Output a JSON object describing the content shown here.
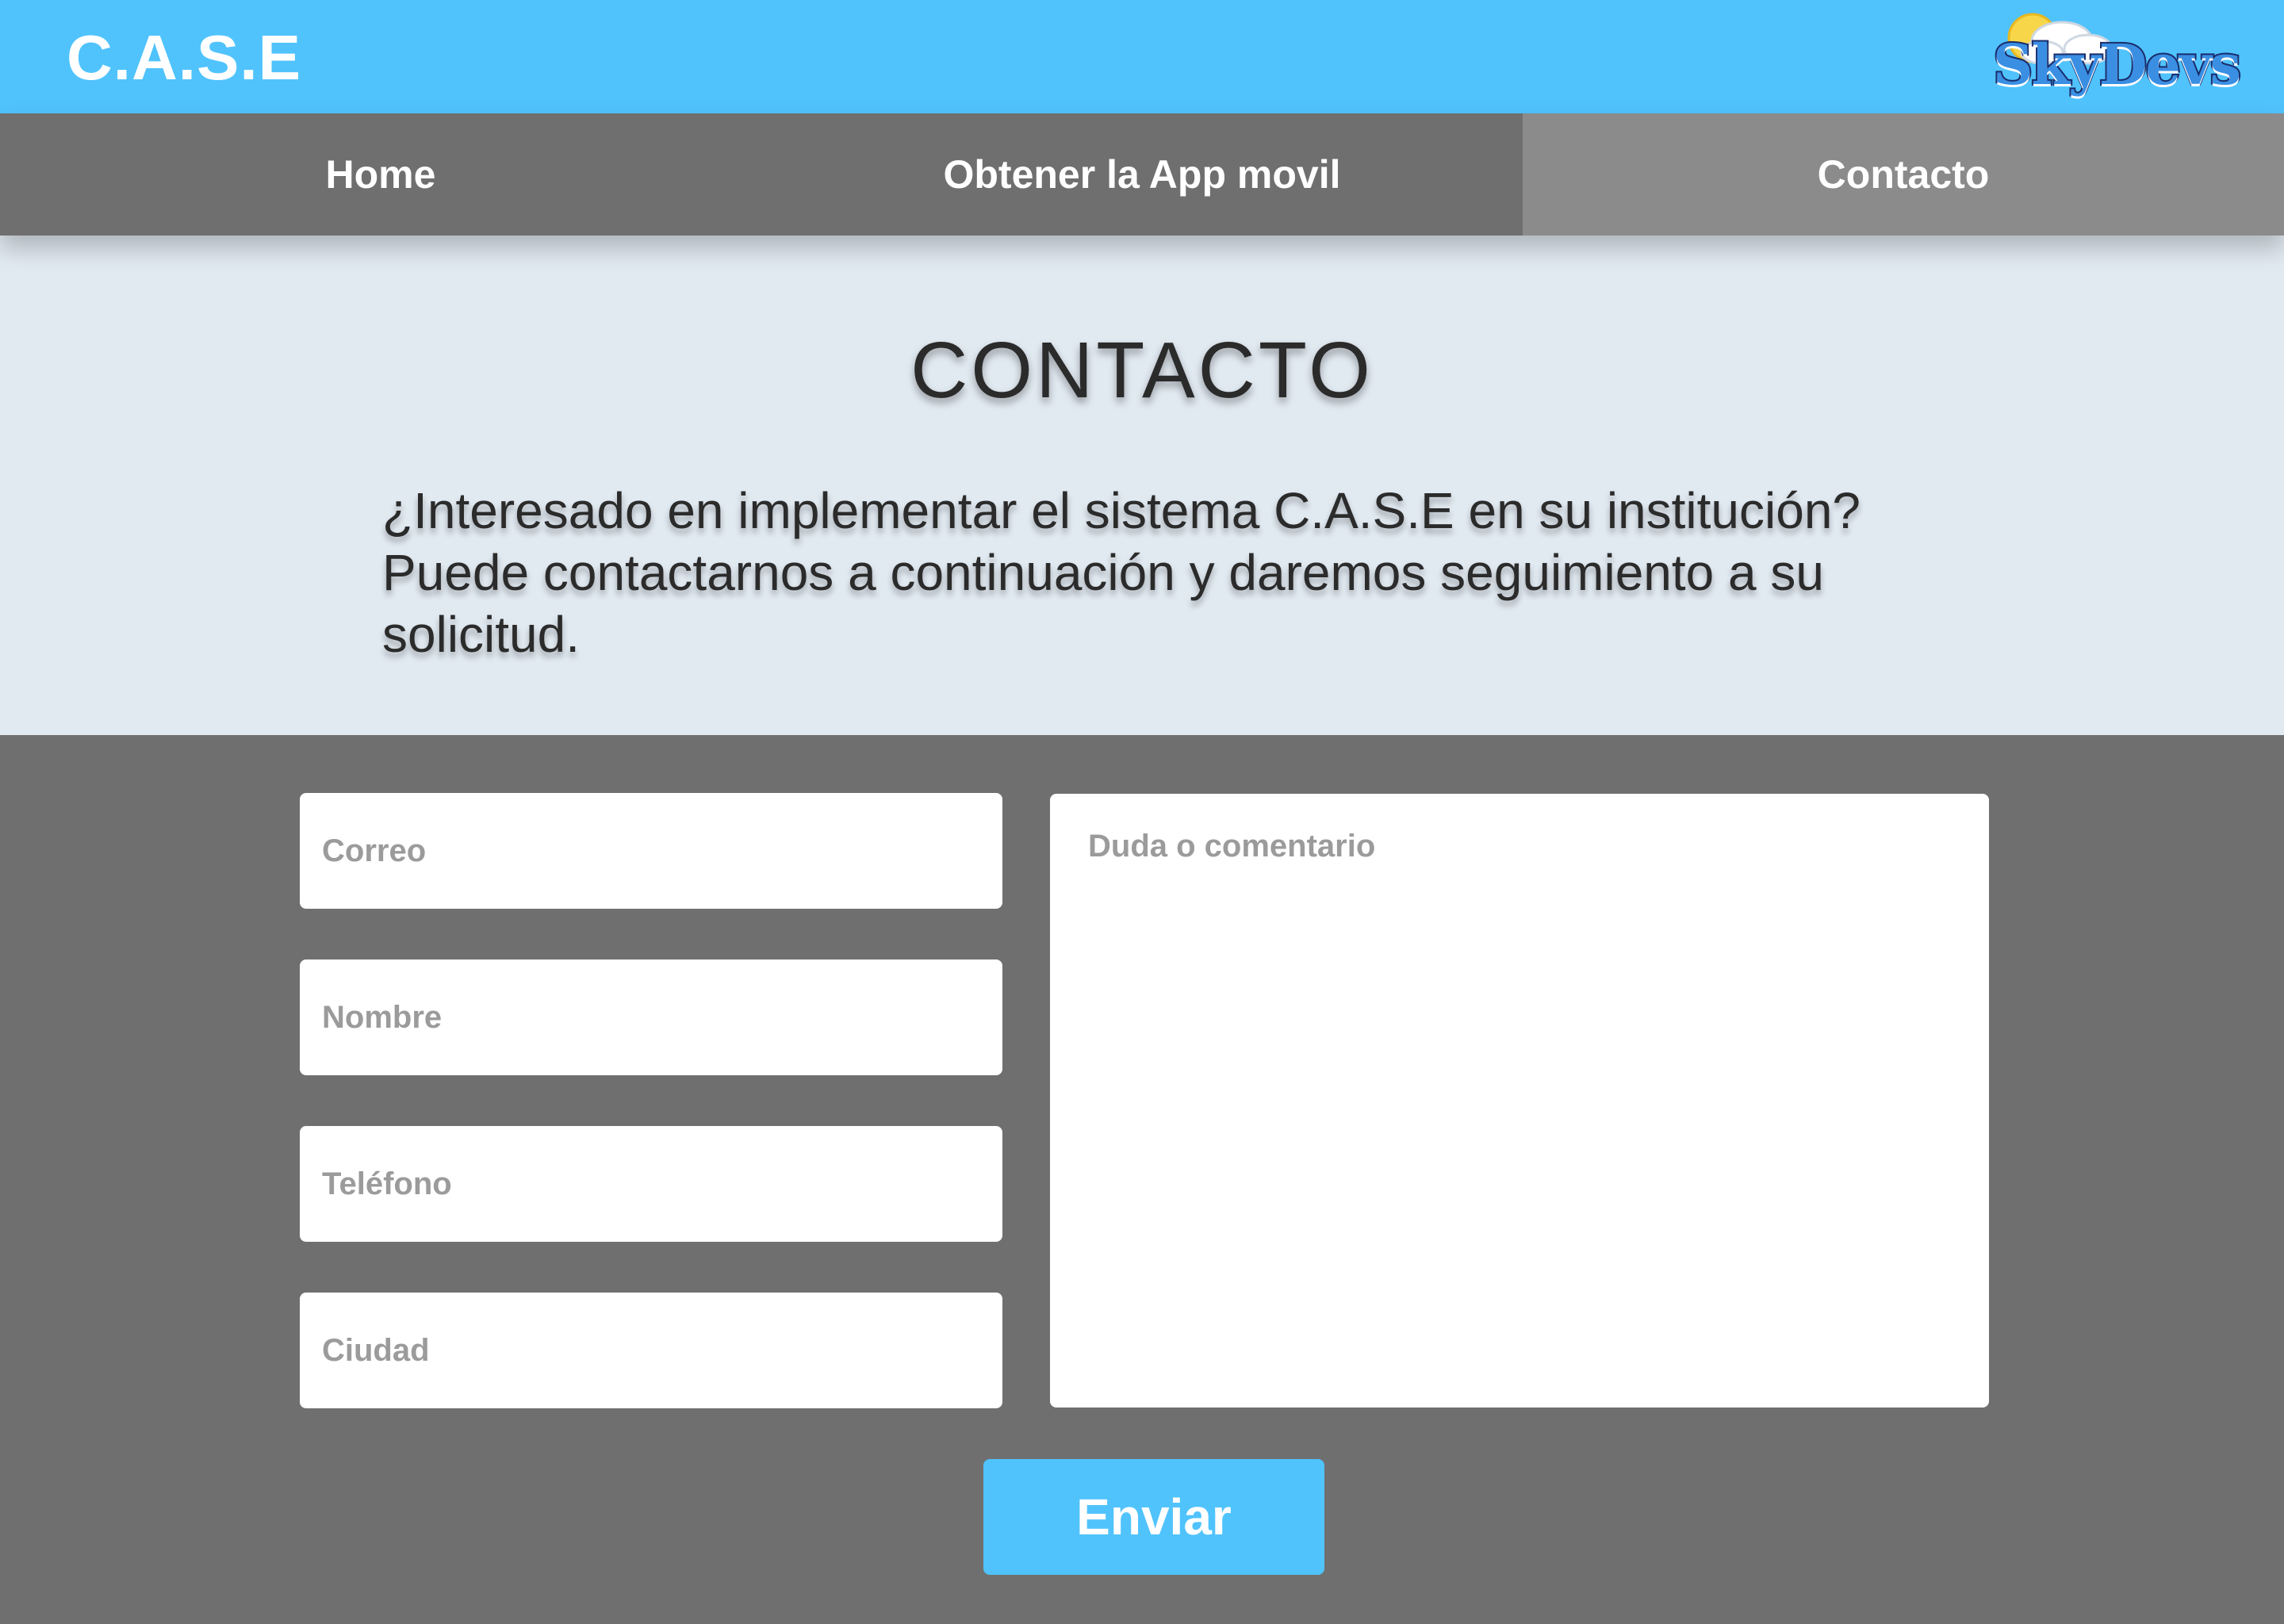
{
  "header": {
    "brand": "C.A.S.E",
    "logo_text": "SkyDevs"
  },
  "nav": {
    "items": [
      {
        "label": "Home",
        "active": false
      },
      {
        "label": "Obtener la App movil",
        "active": false
      },
      {
        "label": "Contacto",
        "active": true
      }
    ]
  },
  "intro": {
    "title": "CONTACTO",
    "text": "¿Interesado en implementar el sistema C.A.S.E en su institución? Puede contactarnos a continuación y daremos seguimiento a su solicitud."
  },
  "form": {
    "correo_placeholder": "Correo",
    "nombre_placeholder": "Nombre",
    "telefono_placeholder": "Teléfono",
    "ciudad_placeholder": "Ciudad",
    "comment_placeholder": "Duda o comentario",
    "submit_label": "Enviar"
  },
  "colors": {
    "header_bg": "#50c3fd",
    "nav_bg": "#6f6f6f",
    "nav_active_bg": "#8b8b8b",
    "intro_bg": "#e1e9f1",
    "form_bg": "#6f6f6f",
    "button_bg": "#50c3fd"
  },
  "icons": {
    "logo": "skydevs-logo-sun-cloud"
  }
}
